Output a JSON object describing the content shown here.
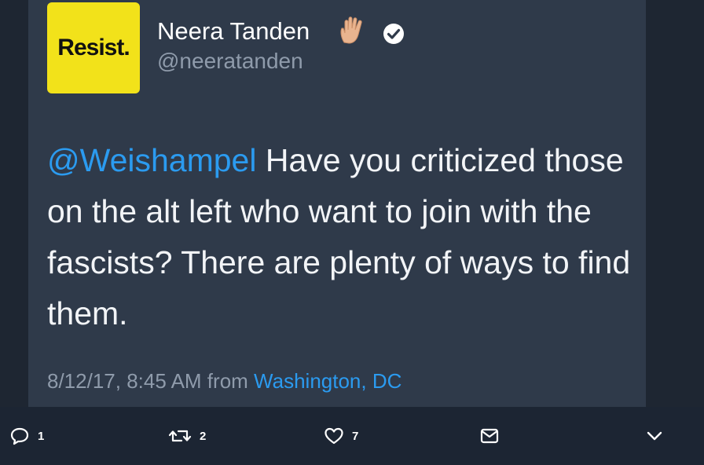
{
  "tweet": {
    "avatar_text": "Resist.",
    "display_name": "Neera Tanden",
    "handle": "@neeratanden",
    "mention": "@Weishampel",
    "body": " Have you criticized those on the alt left who want to join with the fascists? There are plenty of ways to find them.",
    "timestamp": "8/12/17, 8:45 AM from ",
    "location": "Washington, DC"
  },
  "actions": {
    "reply_count": "1",
    "retweet_count": "2",
    "like_count": "7"
  },
  "colors": {
    "background": "#1c2533",
    "card": "#2f3a4a",
    "accent": "#2b9bf0",
    "avatar": "#f2e21a"
  }
}
